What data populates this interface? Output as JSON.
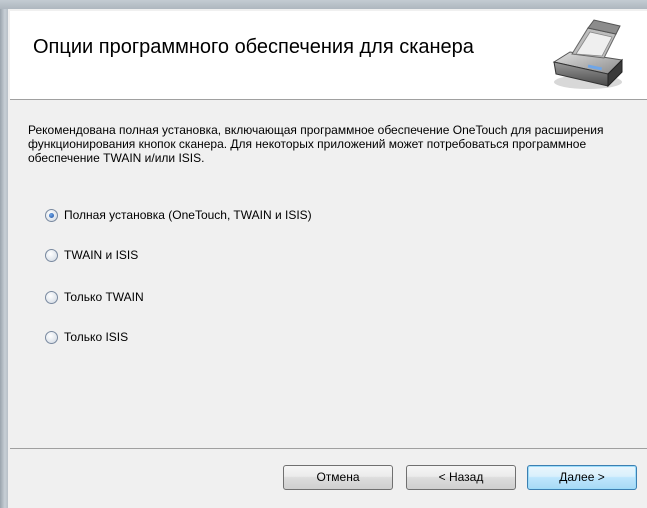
{
  "header": {
    "title": "Опции программного обеспечения для сканера",
    "icon": "scanner-icon"
  },
  "content": {
    "description": "Рекомендована полная установка, включающая программное обеспечение OneTouch для расширения функционирования кнопок сканера. Для некоторых приложений может потребоваться программное обеспечение TWAIN и/или ISIS.",
    "options": [
      {
        "label": "Полная установка (OneTouch, TWAIN и ISIS)",
        "checked": true
      },
      {
        "label": "TWAIN и ISIS",
        "checked": false
      },
      {
        "label": "Только TWAIN",
        "checked": false
      },
      {
        "label": "Только ISIS",
        "checked": false
      }
    ]
  },
  "footer": {
    "cancel_label": "Отмена",
    "back_label": "< Назад",
    "next_label": "Далее >"
  },
  "colors": {
    "header_bg": "#ffffff",
    "dialog_bg": "#f0f0f0",
    "default_button_border": "#3c7fb1"
  }
}
